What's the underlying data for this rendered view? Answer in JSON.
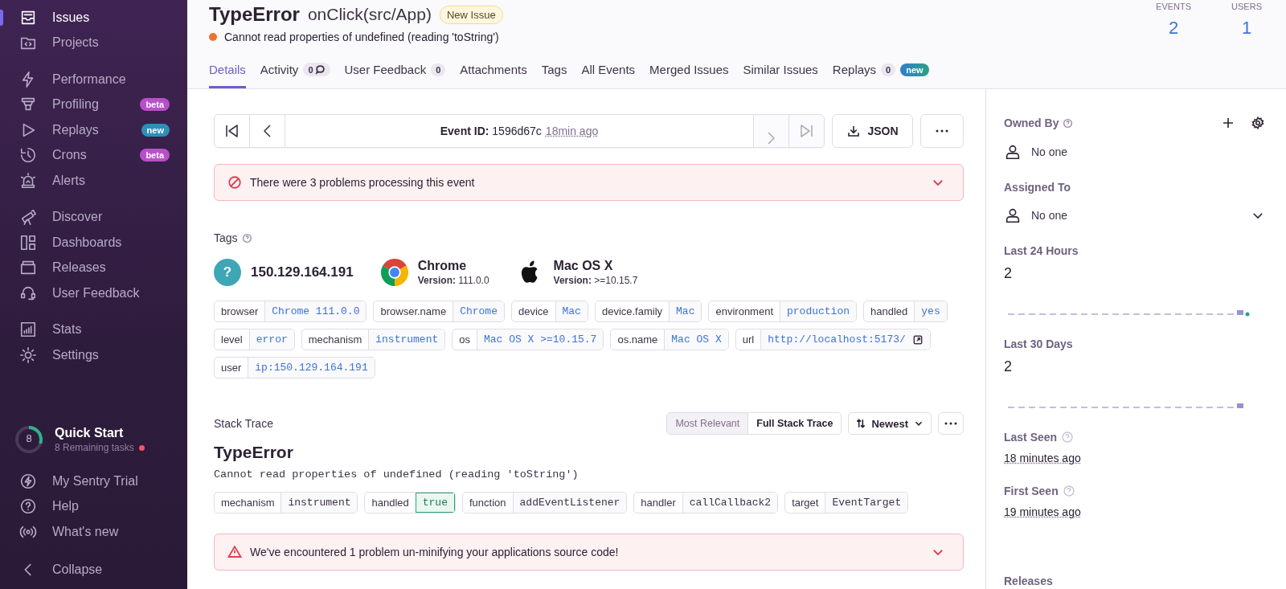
{
  "sidebar": {
    "groups": [
      {
        "items": [
          {
            "label": "Issues",
            "selected": true
          },
          {
            "label": "Projects",
            "selected": false
          }
        ]
      },
      {
        "items": [
          {
            "label": "Performance",
            "selected": false
          },
          {
            "label": "Profiling",
            "selected": false,
            "badge": {
              "text": "beta",
              "color": "#b84fc9"
            }
          },
          {
            "label": "Replays",
            "selected": false,
            "badge": {
              "text": "new",
              "color": "#2f8fb5"
            }
          },
          {
            "label": "Crons",
            "selected": false,
            "badge": {
              "text": "beta",
              "color": "#b84fc9"
            }
          },
          {
            "label": "Alerts",
            "selected": false
          }
        ]
      },
      {
        "items": [
          {
            "label": "Discover",
            "selected": false
          },
          {
            "label": "Dashboards",
            "selected": false
          },
          {
            "label": "Releases",
            "selected": false
          },
          {
            "label": "User Feedback",
            "selected": false
          }
        ]
      },
      {
        "items": [
          {
            "label": "Stats",
            "selected": false
          },
          {
            "label": "Settings",
            "selected": false
          }
        ]
      }
    ],
    "quick_start": {
      "count": "8",
      "level": 0.3,
      "title": "Quick Start",
      "subtitle": "8 Remaining tasks"
    },
    "footer": [
      {
        "label": "My Sentry Trial"
      },
      {
        "label": "Help"
      },
      {
        "label": "What's new"
      },
      {
        "label": "Collapse"
      }
    ]
  },
  "header": {
    "title": "TypeError",
    "subtitle": "onClick(src/App)",
    "status": "New Issue",
    "message": "Cannot read properties of undefined (reading 'toString')",
    "stats": [
      {
        "label": "EVENTS",
        "value": "2"
      },
      {
        "label": "USERS",
        "value": "1"
      }
    ]
  },
  "tabs": [
    {
      "label": "Details",
      "selected": true
    },
    {
      "label": "Activity",
      "selected": false,
      "count": "0"
    },
    {
      "label": "User Feedback",
      "selected": false,
      "count": "0"
    },
    {
      "label": "Attachments",
      "selected": false
    },
    {
      "label": "Tags",
      "selected": false
    },
    {
      "label": "All Events",
      "selected": false
    },
    {
      "label": "Merged Issues",
      "selected": false
    },
    {
      "label": "Similar Issues",
      "selected": false
    },
    {
      "label": "Replays",
      "selected": false,
      "count": "0",
      "badge": "new"
    }
  ],
  "event_nav": {
    "nav_buttons": [
      {
        "kind": "first",
        "disabled": false
      },
      {
        "kind": "previous",
        "disabled": false
      },
      {
        "kind": "next",
        "disabled": true
      },
      {
        "kind": "last",
        "disabled": true
      }
    ],
    "label": "Event ID:",
    "id": "1596d67c",
    "age": "18min ago",
    "json_button": "JSON"
  },
  "processing_alert": "There were 3 problems processing this event",
  "tags": {
    "title": "Tags",
    "summary": [
      {
        "kind": "unknown",
        "icon_text": "?",
        "title": "150.129.164.191"
      },
      {
        "kind": "browser",
        "title": "Chrome",
        "version_label": "Version:",
        "version": "111.0.0"
      },
      {
        "kind": "os",
        "title": "Mac OS X",
        "version_label": "Version:",
        "version": ">=10.15.7"
      }
    ],
    "pairs": [
      {
        "key": "browser",
        "value": "Chrome 111.0.0"
      },
      {
        "key": "browser.name",
        "value": "Chrome"
      },
      {
        "key": "device",
        "value": "Mac"
      },
      {
        "key": "device.family",
        "value": "Mac"
      },
      {
        "key": "environment",
        "value": "production"
      },
      {
        "key": "handled",
        "value": "yes"
      },
      {
        "key": "level",
        "value": "error"
      },
      {
        "key": "mechanism",
        "value": "instrument"
      },
      {
        "key": "os",
        "value": "Mac OS X >=10.15.7"
      },
      {
        "key": "os.name",
        "value": "Mac OS X"
      },
      {
        "key": "url",
        "value": "http://localhost:5173/",
        "external": true
      },
      {
        "key": "user",
        "value": "ip:150.129.164.191"
      }
    ]
  },
  "stack_trace": {
    "title": "Stack Trace",
    "views": [
      {
        "label": "Most Relevant",
        "selected": false
      },
      {
        "label": "Full Stack Trace",
        "selected": true
      }
    ],
    "sort": "Newest",
    "exception_type": "TypeError",
    "exception_value": "Cannot read properties of undefined (reading 'toString')",
    "mechanism": [
      {
        "key": "mechanism",
        "value": "instrument",
        "highlighted": false
      },
      {
        "key": "handled",
        "value": "true",
        "highlighted": true
      },
      {
        "key": "function",
        "value": "addEventListener",
        "highlighted": false
      },
      {
        "key": "handler",
        "value": "callCallback2",
        "highlighted": false
      },
      {
        "key": "target",
        "value": "EventTarget",
        "highlighted": false
      }
    ],
    "alert": "We've encountered 1 problem un-minifying your applications source code!"
  },
  "side_panel": {
    "owned_by": {
      "title": "Owned By",
      "value": "No one"
    },
    "assigned_to": {
      "title": "Assigned To",
      "value": "No one"
    },
    "counts": [
      {
        "title": "Last 24 Hours",
        "value": "2"
      },
      {
        "title": "Last 30 Days",
        "value": "2"
      }
    ],
    "seen": [
      {
        "title": "Last Seen",
        "value": "18 minutes ago"
      },
      {
        "title": "First Seen",
        "value": "19 minutes ago"
      }
    ],
    "next_section": "Releases"
  }
}
